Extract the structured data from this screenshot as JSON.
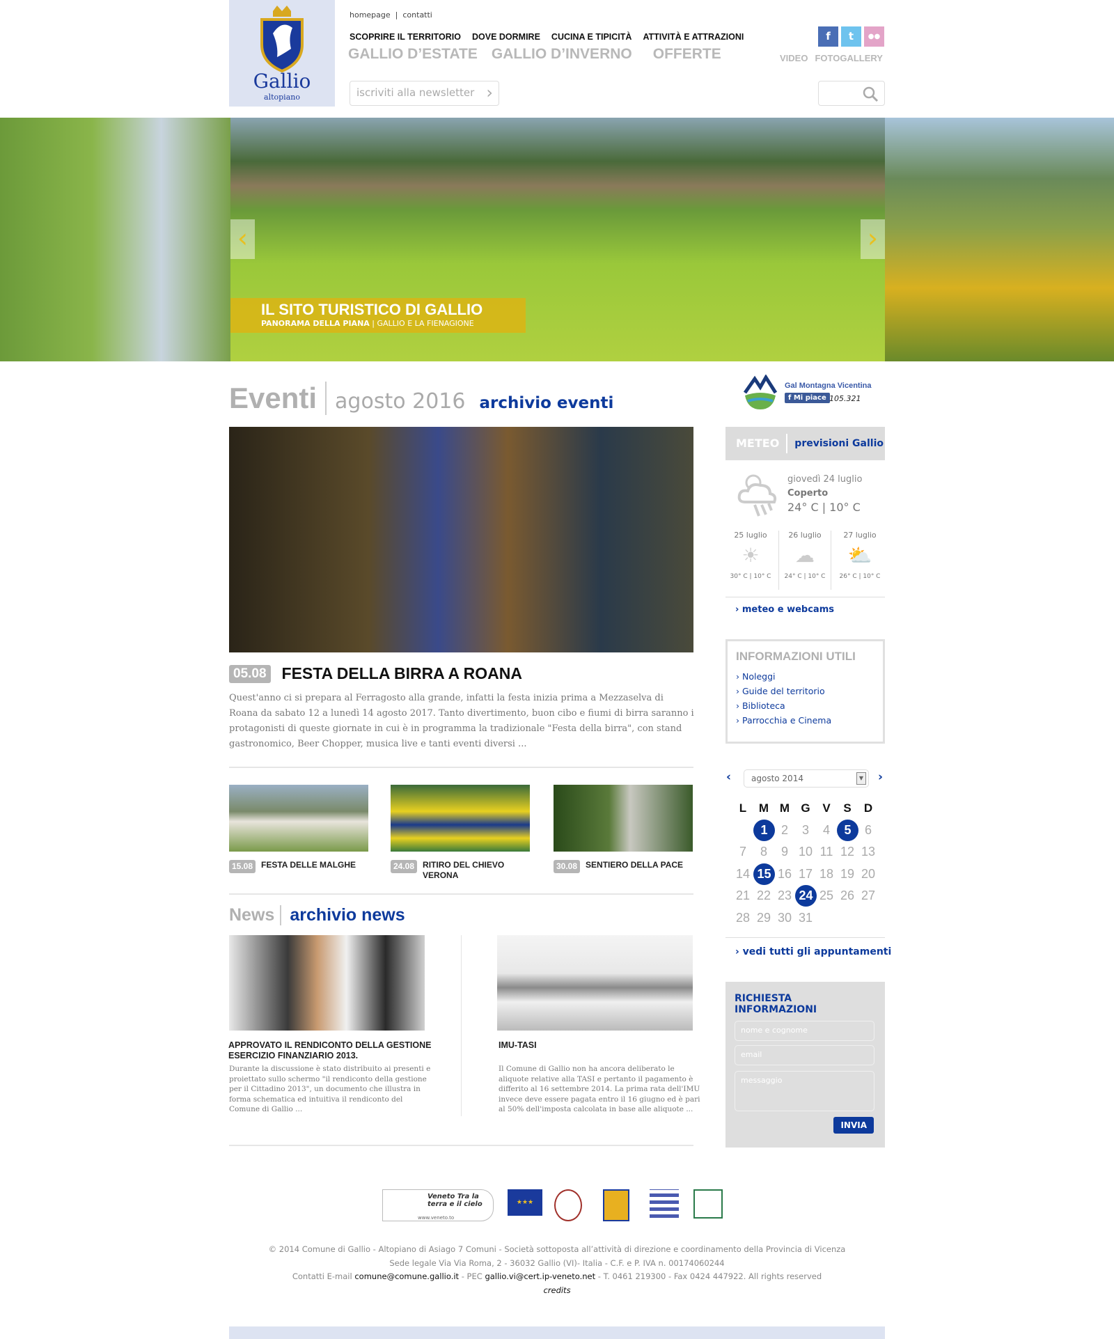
{
  "header": {
    "logo_name": "Gallio",
    "logo_sub": "altopiano",
    "top_links": [
      "homepage",
      "contatti"
    ],
    "nav_main": [
      "SCOPRIRE IL TERRITORIO",
      "DOVE DORMIRE",
      "CUCINA E TIPICITÀ",
      "ATTIVITÀ E ATTRAZIONI"
    ],
    "nav_seasons": [
      "GALLIO D’ESTATE",
      "GALLIO D’INVERNO",
      "OFFERTE"
    ],
    "newsletter_placeholder": "iscriviti alla newsletter",
    "media_links": [
      "VIDEO",
      "FOTOGALLERY"
    ],
    "social": [
      {
        "icon": "facebook-icon",
        "glyph": "f",
        "color": "#4a6eb5"
      },
      {
        "icon": "twitter-icon",
        "glyph": "t",
        "color": "#6ec3ee"
      },
      {
        "icon": "flickr-icon",
        "glyph": "••",
        "color": "#e3a4c8"
      }
    ]
  },
  "hero": {
    "title": "IL SITO TURISTICO DI GALLIO",
    "subtitle_bold": "PANORAMA DELLA PIANA",
    "subtitle": "GALLIO E LA FIENAGIONE"
  },
  "events": {
    "title": "Eventi",
    "month": "agosto 2016",
    "archive": "archivio eventi",
    "featured": {
      "date": "05.08",
      "title": "FESTA DELLA BIRRA A ROANA",
      "text": "Quest'anno ci si prepara al Ferragosto alla grande, infatti la festa inizia prima a Mezzaselva di Roana da sabato 12 a lunedì 14 agosto 2017. Tanto divertimento, buon cibo e fiumi di birra saranno i protagonisti di queste giornate in cui è in programma la tradizionale \"Festa della birra\", con stand gastronomico, Beer Chopper, musica live e tanti eventi diversi ..."
    },
    "items": [
      {
        "date": "15.08",
        "title": "FESTA DELLE MALGHE"
      },
      {
        "date": "24.08",
        "title": "RITIRO DEL CHIEVO VERONA"
      },
      {
        "date": "30.08",
        "title": "SENTIERO DELLA PACE"
      }
    ]
  },
  "news": {
    "title": "News",
    "archive": "archivio news",
    "items": [
      {
        "title": "APPROVATO IL RENDICONTO DELLA GESTIONE ESERCIZIO FINANZIARIO 2013.",
        "text": "Durante la discussione è stato distribuito ai presenti e proiettato sullo schermo \"il rendiconto della gestione per il Cittadino 2013\", un documento che illustra in forma schematica ed intuitiva il rendiconto del Comune di Gallio ..."
      },
      {
        "title": "IMU-TASI",
        "text": "Il Comune di Gallio non ha ancora deliberato le aliquote relative alla TASI e pertanto il pagamento è differito al 16 settembre 2014. La prima rata dell'IMU invece deve essere pagata entro il 16 giugno ed è pari al 50% dell'imposta calcolata in base alle aliquote ..."
      }
    ]
  },
  "sidebar": {
    "gal": {
      "name": "Gal Montagna Vicentina",
      "like": "Mi piace",
      "count": "105.321"
    },
    "meteo": {
      "label": "METEO",
      "link": "previsioni Gallio",
      "today": {
        "date": "giovedì 24 luglio",
        "condition": "Coperto",
        "temp": "24° C | 10° C"
      },
      "forecast": [
        {
          "date": "25 luglio",
          "icon": "sun-icon",
          "temp": "30° C | 10° C"
        },
        {
          "date": "26 luglio",
          "icon": "storm-cloud-icon",
          "temp": "24° C | 10° C"
        },
        {
          "date": "27 luglio",
          "icon": "rain-cloud-icon",
          "temp": "26° C | 10° C"
        }
      ],
      "webcams": "› meteo e webcams"
    },
    "info": {
      "title": "INFORMAZIONI UTILI",
      "links": [
        "› Noleggi",
        "› Guide del territorio",
        "› Biblioteca",
        "› Parrocchia e Cinema"
      ]
    },
    "calendar": {
      "month": "agosto 2014",
      "weekdays": [
        "L",
        "M",
        "M",
        "G",
        "V",
        "S",
        "D"
      ],
      "first_col": 1,
      "days": 31,
      "event_days": [
        1,
        5,
        15,
        24
      ],
      "all_link": "› vedi tutti gli appuntamenti"
    },
    "request": {
      "title": "RICHIESTA INFORMAZIONI",
      "name_ph": "nome e cognome",
      "email_ph": "email",
      "msg_ph": "messaggio",
      "submit": "INVIA"
    }
  },
  "footer": {
    "logos": [
      "Veneto Tra la terra e il cielo",
      "FEASR",
      "Repubblica Italiana",
      "Regione del Veneto",
      "PSR Veneto 2007-2013",
      "Leader"
    ],
    "veneto_url": "www.veneto.to",
    "line1": "© 2014 Comune di Gallio - Altopiano di Asiago 7 Comuni - Società sottoposta all’attività di direzione e coordinamento della Provincia di Vicenza",
    "line2": "Sede legale Via Via Roma, 2 - 36032 Gallio (VI)- Italia - C.F. e P. IVA n. 00174060244",
    "contact_pre": "Contatti  E-mail",
    "email": "comune@comune.gallio.it",
    "pec_pre": "- PEC",
    "pec": "gallio.vi@cert.ip-veneto.net",
    "contact_post": "- T. 0461 219300 - Fax 0424 447922. All rights reserved",
    "credits": "credits"
  },
  "colors": {
    "brand_blue": "#0d3a9c",
    "logo_bg": "#dde3f2",
    "hero_accent": "#dcb414"
  }
}
